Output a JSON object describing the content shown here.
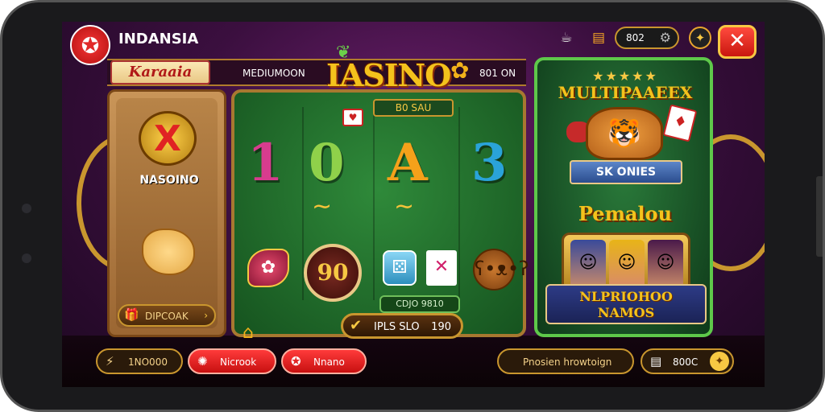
{
  "top_bar": {
    "brand": "INDANSIA",
    "coins": "802",
    "close_label": "✕"
  },
  "header": {
    "tag_left": "Karaaia",
    "mode": "MEDIUMOON",
    "title": "IASINO",
    "right_tag": "801 ON"
  },
  "left_panel": {
    "badge_label": "NASOINO",
    "button_label": "DIPCOAK"
  },
  "board": {
    "top_pill": "B0 SAU",
    "symbols": [
      "1",
      "0",
      "A",
      "3"
    ],
    "chip_value": "90",
    "code": "CDJO 9810",
    "play_label": "IPLS SLO",
    "play_value": "190"
  },
  "right_panel": {
    "stars": "★★★★★",
    "title": "MULTIPAAEEX",
    "ribbon": "SK ONIES",
    "subtitle": "Pemalou",
    "banner_line1": "NLPRIOHOO",
    "banner_line2": "NAMOS"
  },
  "bottom_bar": {
    "btn1": "1NO000",
    "btn2": "Nicrook",
    "btn3": "Nnano",
    "btn4": "Pnosien hrowtoign",
    "btn5": "800C"
  },
  "icons": {
    "logo": "star-logo-icon",
    "teapot": "teapot-icon",
    "jar": "jar-icon",
    "gear": "gear-icon",
    "gold_coin": "gold-coin-icon"
  },
  "colors": {
    "accent_gold": "#f4c21c",
    "board_green": "#2f8a3a",
    "close_red": "#d9201a",
    "background_purple": "#3b0f3f"
  }
}
